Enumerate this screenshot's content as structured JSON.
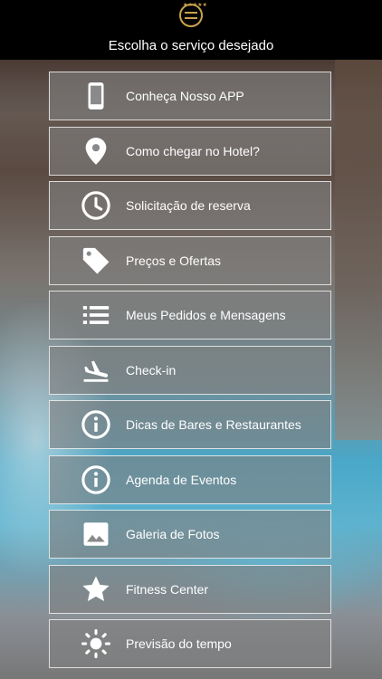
{
  "header": {
    "title": "Escolha o serviço desejado",
    "logo": "hotel-logo"
  },
  "menu": {
    "items": [
      {
        "label": "Conheça Nosso APP",
        "icon": "phone-icon"
      },
      {
        "label": "Como chegar no Hotel?",
        "icon": "location-pin-icon"
      },
      {
        "label": "Solicitação de reserva",
        "icon": "clock-icon"
      },
      {
        "label": "Preços e Ofertas",
        "icon": "tag-icon"
      },
      {
        "label": "Meus Pedidos e Mensagens",
        "icon": "list-icon"
      },
      {
        "label": "Check-in",
        "icon": "airplane-landing-icon"
      },
      {
        "label": "Dicas de Bares e Restaurantes",
        "icon": "info-icon"
      },
      {
        "label": "Agenda de Eventos",
        "icon": "info-icon"
      },
      {
        "label": "Galeria de Fotos",
        "icon": "image-icon"
      },
      {
        "label": "Fitness Center",
        "icon": "star-icon"
      },
      {
        "label": "Previsão do tempo",
        "icon": "sun-icon"
      }
    ]
  },
  "colors": {
    "header_bg": "#000000",
    "item_bg": "rgba(128,128,128,0.62)",
    "item_border": "#ffffff",
    "text": "#ffffff",
    "logo_gold": "#c9a24a"
  }
}
